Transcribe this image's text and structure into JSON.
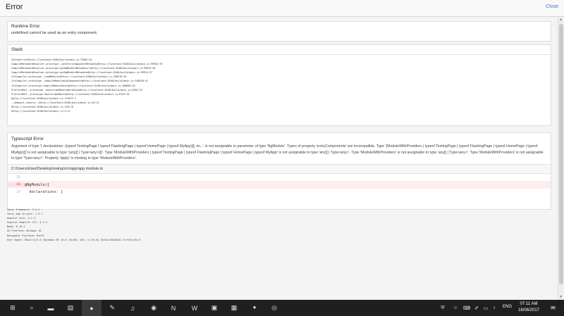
{
  "window": {
    "title": "Error",
    "close_label": "Close"
  },
  "runtime_error": {
    "heading": "Runtime Error",
    "message": "undefined cannot be used as an entry component."
  },
  "stack": {
    "heading": "Stack",
    "lines": [
      "SyntaxError@http://localhost:8100/build/main.js:79483:34",
      "CompileMetadataResolver.prototype._getEntryComponentMetadata@http://localhost:8100/build/main.js:99942:19",
      "CompileMetadataResolver.prototype.getNgModuleMetadata/<@http://localhost:8100/build/main.js:99913:40",
      "CompileMetadataResolver.prototype.getNgModuleMetadata@http://localhost:8100/build/main.js:99914:57",
      "JitCompiler.prototype._loadModules@http://localhost:8100/build/main.js:106976:43",
      "JitCompiler.prototype._compileModuleAndComponents@http://localhost:8100/build/main.js:106934:47",
      "JitCompiler.prototype.compileModuleAsync@http://localhost:8100/build/main.js:106896:16",
      "PlatformRef_.prototype._bootstrapModuleWithZone@http://localhost:8100/build/main.js:6162:16",
      "PlatformRef_.prototype.bootstrapModule@http://localhost:8100/build/main.js:6149:16",
      "@http://localhost:8100/build/main.js:114077:1",
      "__webpack_require__@http://localhost:8100/build/main.js:20:12",
      "@http://localhost:8100/build/main.js:146:18",
      "@http://localhost:8100/build/main.js:1:11"
    ]
  },
  "typescript_error": {
    "heading": "Typescript Error",
    "message": "Argument of type '{ declarations: (typeof TextingPage | typeof FlashingPage | typeof HomePage | typeof MyApp)[]; im...' is not assignable to parameter of type 'NgModule'. Types of property 'entryComponents' are incompatible. Type '(ModuleWithProviders | typeof TextingPage | typeof FlashingPage | typeof HomePage | typeof MyApp)[]' is not assignable to type '(any[] | Type<any>)[]'. Type 'ModuleWithProviders | typeof TextingPage | typeof FlashingPage | typeof HomePage | typeof MyApp' is not assignable to type 'any[] | Type<any>'. Type 'ModuleWithProviders' is not assignable to type 'any[] | Type<any>'. Type 'ModuleWithProviders' is not assignable to type 'Type<any>'. Property 'apply' is missing in type 'ModuleWithProviders'.",
    "file": "C:/Users/shari/Desktop/swing/src/app/app.module.ts",
    "code": [
      {
        "num": "15",
        "text": ""
      },
      {
        "num": "16",
        "text": "@NgModule({"
      },
      {
        "num": "17",
        "text": "  declarations: ["
      }
    ]
  },
  "system_info": [
    "Ionic Framework: 3.4.2",
    "Ionic App Scripts: 1.3.7",
    "Angular Core: 4.1.3",
    "Angular Compiler CLI: 4.1.3",
    "Node: 6.10.1",
    "OS Platform: Windows 10",
    "Navigator Platform: Win32",
    "User Agent: Mozilla/5.0 (Windows NT 10.0; Win64; x64; rv:54.0) Gecko/20100101 Firefox/54.0"
  ],
  "taskbar": {
    "apps": [
      {
        "name": "start-icon",
        "glyph": "⊞"
      },
      {
        "name": "search-icon",
        "glyph": "⌕"
      },
      {
        "name": "sticky-notes-icon",
        "glyph": "▬"
      },
      {
        "name": "file-explorer-icon",
        "glyph": "▤"
      },
      {
        "name": "firefox-icon",
        "glyph": "●"
      },
      {
        "name": "notepad-icon",
        "glyph": "✎"
      },
      {
        "name": "voice-recorder-icon",
        "glyph": "♫"
      },
      {
        "name": "android-studio-icon",
        "glyph": "◉"
      },
      {
        "name": "onenote-icon",
        "glyph": "N"
      },
      {
        "name": "webstorm-icon",
        "glyph": "W"
      },
      {
        "name": "terminal-icon",
        "glyph": "▣"
      },
      {
        "name": "calculator-icon",
        "glyph": "▦"
      },
      {
        "name": "network-app-icon",
        "glyph": "✦"
      },
      {
        "name": "chrome-icon",
        "glyph": "◎"
      }
    ],
    "tray": [
      {
        "name": "security-shield-icon",
        "glyph": "⛨"
      },
      {
        "name": "people-icon",
        "glyph": "☺"
      },
      {
        "name": "keyboard-icon",
        "glyph": "⌨"
      },
      {
        "name": "pen-icon",
        "glyph": "✐"
      },
      {
        "name": "battery-icon",
        "glyph": "▭"
      },
      {
        "name": "volume-icon",
        "glyph": "♪"
      }
    ],
    "language": "ENG",
    "time": "07:11 AM",
    "date": "18/06/2017",
    "notifications_glyph": "✉"
  }
}
